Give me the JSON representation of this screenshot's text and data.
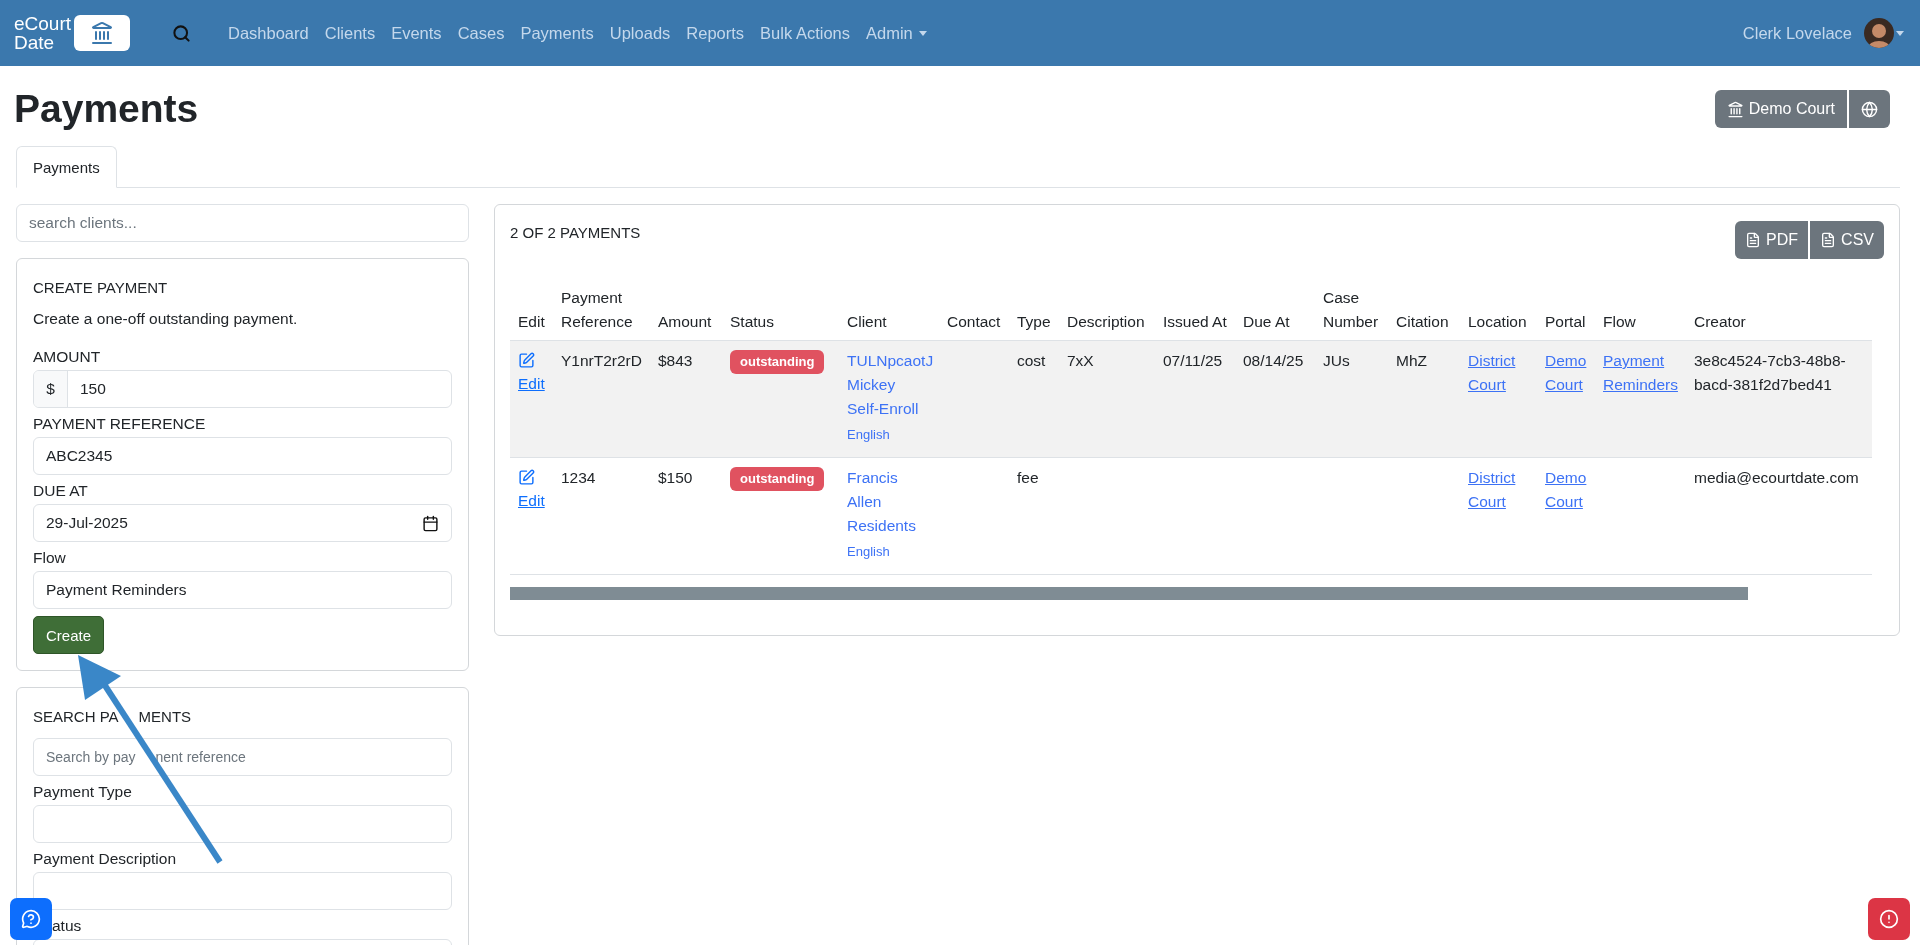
{
  "navbar": {
    "logo": "eCourt Date",
    "links": [
      {
        "label": "Dashboard",
        "selected": false
      },
      {
        "label": "Clients",
        "selected": false
      },
      {
        "label": "Events",
        "selected": false
      },
      {
        "label": "Cases",
        "selected": false
      },
      {
        "label": "Payments",
        "selected": false
      },
      {
        "label": "Uploads",
        "selected": false
      },
      {
        "label": "Reports",
        "selected": false
      },
      {
        "label": "Bulk Actions",
        "selected": false
      },
      {
        "label": "Admin",
        "selected": false,
        "dropdown": true
      }
    ],
    "user": "Clerk Lovelace"
  },
  "page_title": "Payments",
  "court_button": "Demo Court",
  "tabs": [
    {
      "label": "Payments",
      "selected": true
    }
  ],
  "client_search": {
    "placeholder": "search clients..."
  },
  "create_payment": {
    "title": "CREATE PAYMENT",
    "description": "Create a one-off outstanding payment.",
    "fields": [
      {
        "kind": "currency",
        "label": "AMOUNT",
        "prefix": "$",
        "value": "150"
      },
      {
        "kind": "text",
        "label": "PAYMENT REFERENCE",
        "value": "ABC2345"
      },
      {
        "kind": "date",
        "label": "DUE AT",
        "value": "29-Jul-2025"
      },
      {
        "kind": "text",
        "label": "Flow",
        "value": "Payment Reminders"
      }
    ],
    "button": "Create"
  },
  "search_payments": {
    "title": [
      "SEARCH PA",
      "MENTS"
    ],
    "fields": [
      {
        "kind": "split",
        "placeholder": [
          "Search by pay",
          "nent reference"
        ]
      },
      {
        "kind": "text",
        "label": "Payment Type"
      },
      {
        "kind": "text",
        "label": "Payment Description"
      },
      {
        "kind": "text",
        "label": "atus",
        "clipped_left": true
      }
    ]
  },
  "payments": {
    "count": "2 OF 2 PAYMENTS",
    "exports": [
      "PDF",
      "CSV"
    ],
    "columns": [
      "Edit",
      "Payment Reference",
      "Amount",
      "Status",
      "Client",
      "Contact",
      "Type",
      "Description",
      "Issued At",
      "Due At",
      "Case Number",
      "Citation",
      "Location",
      "Portal",
      "Flow",
      "Creator"
    ],
    "rows": [
      {
        "edit": "Edit",
        "reference": "Y1nrT2r2rD",
        "amount": "$843",
        "status": "outstanding",
        "client": "TULNpcaotJ Mickey Self-Enroll",
        "language": "English",
        "type": "cost",
        "description": "7xX",
        "issued_at": "07/11/25",
        "due_at": "08/14/25",
        "case_number": "JUs",
        "citation": "MhZ",
        "location": "District Court",
        "portal": "Demo Court",
        "flow": "Payment Reminders",
        "creator": "3e8c4524-7cb3-48b8-bacd-381f2d7bed41"
      },
      {
        "edit": "Edit",
        "reference": "1234",
        "amount": "$150",
        "status": "outstanding",
        "client": "Francis Allen Residents",
        "language": "English",
        "type": "fee",
        "location": "District Court",
        "portal": "Demo Court",
        "creator": "media@ecourtdate.com"
      }
    ]
  }
}
